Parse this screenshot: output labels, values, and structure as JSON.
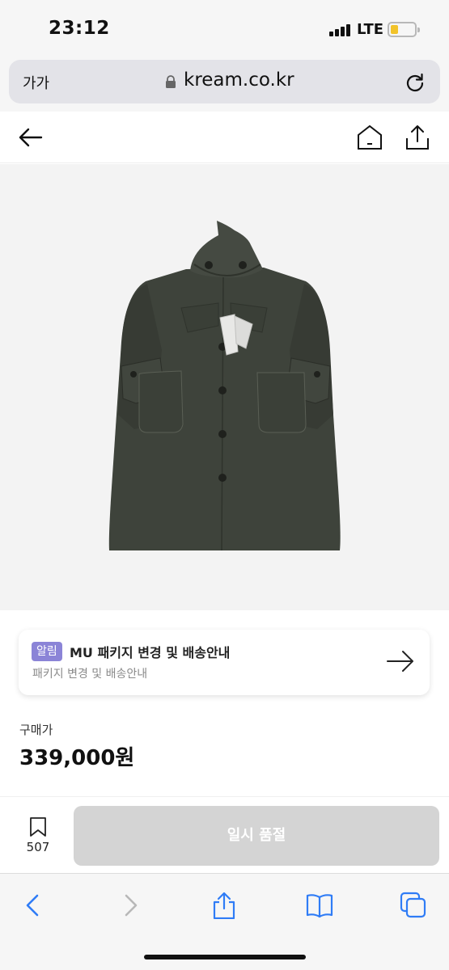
{
  "status": {
    "time": "23:12",
    "network": "LTE"
  },
  "browser": {
    "text_size_label": "가가",
    "domain": "kream.co.kr"
  },
  "notice": {
    "badge": "알림",
    "title": "MU 패키지 변경 및 배송안내",
    "subtitle": "패키지 변경 및 배송안내"
  },
  "product": {
    "price_label": "구매가",
    "price": "339,000원"
  },
  "actions": {
    "bookmark_count": "507",
    "buy_button_label": "일시 품절"
  },
  "colors": {
    "accent_badge": "#8b84d7",
    "disabled_button": "#d4d4d4",
    "ios_blue": "#2f7cf6",
    "coat": "#3e433b"
  }
}
